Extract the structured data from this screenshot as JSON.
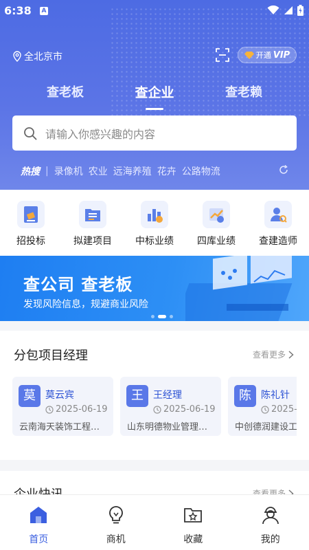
{
  "status": {
    "time": "6:38",
    "badge": "A"
  },
  "header": {
    "location": "全北京市",
    "vip_label": "开通",
    "vip_badge": "VIP",
    "tabs": [
      {
        "label": "查老板"
      },
      {
        "label": "查企业"
      },
      {
        "label": "查老赖"
      }
    ],
    "active_tab": 1,
    "search_placeholder": "请输入你感兴趣的内容",
    "hot_label": "热搜",
    "hot_sep": "|",
    "hot_terms": [
      "录像机",
      "农业",
      "远海养殖",
      "花卉",
      "公路物流"
    ]
  },
  "quick": [
    {
      "label": "招投标",
      "icon": "bid-icon"
    },
    {
      "label": "拟建项目",
      "icon": "project-list-icon"
    },
    {
      "label": "中标业绩",
      "icon": "bar-chart-icon"
    },
    {
      "label": "四库业绩",
      "icon": "trend-chart-icon"
    },
    {
      "label": "查建造师",
      "icon": "engineer-search-icon"
    }
  ],
  "banner": {
    "title": "查公司 查老板",
    "subtitle": "发现风险信息，规避商业风险"
  },
  "section1": {
    "title": "分包项目经理",
    "more": "查看更多",
    "people": [
      {
        "avatar": "莫",
        "name": "莫云宾",
        "date": "2025-06-19",
        "company": "云南海天装饰工程…"
      },
      {
        "avatar": "王",
        "name": "王经理",
        "date": "2025-06-19",
        "company": "山东明德物业管理…"
      },
      {
        "avatar": "陈",
        "name": "陈礼针",
        "date": "2025-0",
        "company": "中创德润建设工"
      }
    ]
  },
  "section2": {
    "title": "企业快讯",
    "more": "查看更多"
  },
  "tabbar": [
    {
      "label": "首页",
      "icon": "home-icon"
    },
    {
      "label": "商机",
      "icon": "lightbulb-icon"
    },
    {
      "label": "收藏",
      "icon": "favorites-folder-icon"
    },
    {
      "label": "我的",
      "icon": "profile-icon"
    }
  ],
  "colors": {
    "header": "#4d6be3",
    "accent": "#3b5fe0",
    "banner": "#1e7ef2"
  }
}
